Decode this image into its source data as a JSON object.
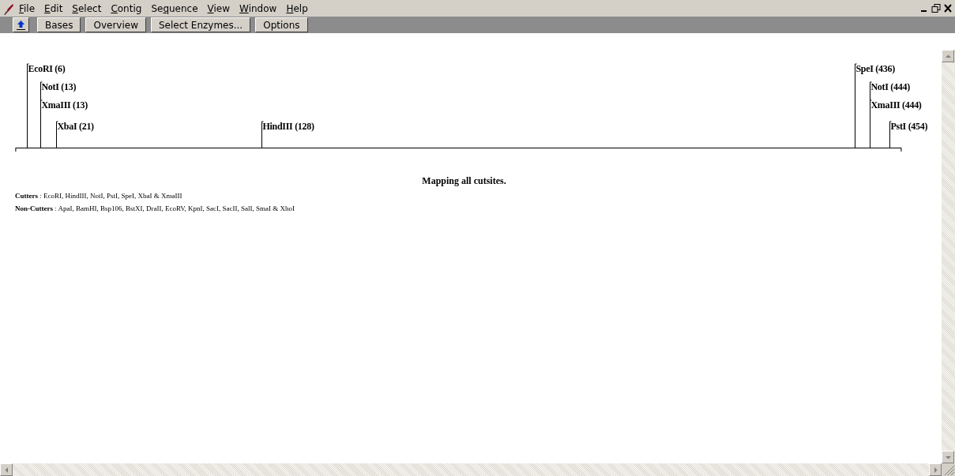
{
  "menu": [
    {
      "key": "F",
      "rest": "ile"
    },
    {
      "key": "E",
      "rest": "dit"
    },
    {
      "key": "S",
      "rest": "elect"
    },
    {
      "key": "C",
      "rest": "ontig"
    },
    {
      "before": "Se",
      "key": "q",
      "rest": "uence"
    },
    {
      "key": "V",
      "rest": "iew"
    },
    {
      "key": "W",
      "rest": "indow"
    },
    {
      "key": "H",
      "rest": "elp"
    }
  ],
  "toolbar": [
    "Bases",
    "Overview",
    "Select Enzymes...",
    "Options"
  ],
  "cutsite_rows": [
    [
      "EcoRI (6)",
      "SpeI (436)"
    ],
    [
      "NotI (13)",
      "NotI (444)"
    ],
    [
      "XmaIII (13)",
      "XmaIII (444)"
    ],
    [
      "XbaI (21)",
      "HindIII (128)",
      "PstI (454)"
    ]
  ],
  "heading": "Mapping all cutsites.",
  "summary": [
    "**Cutters** : EcoRI, HindIII, NotI, PstI, SpeI, XbaI & XmaIII",
    "**Non-Cutters** : ApaI, BamHI, Bsp106, BstXI, DraII, EcoRV, KpnI, SacI, SacII, SalI, SmaI & XhoI"
  ]
}
